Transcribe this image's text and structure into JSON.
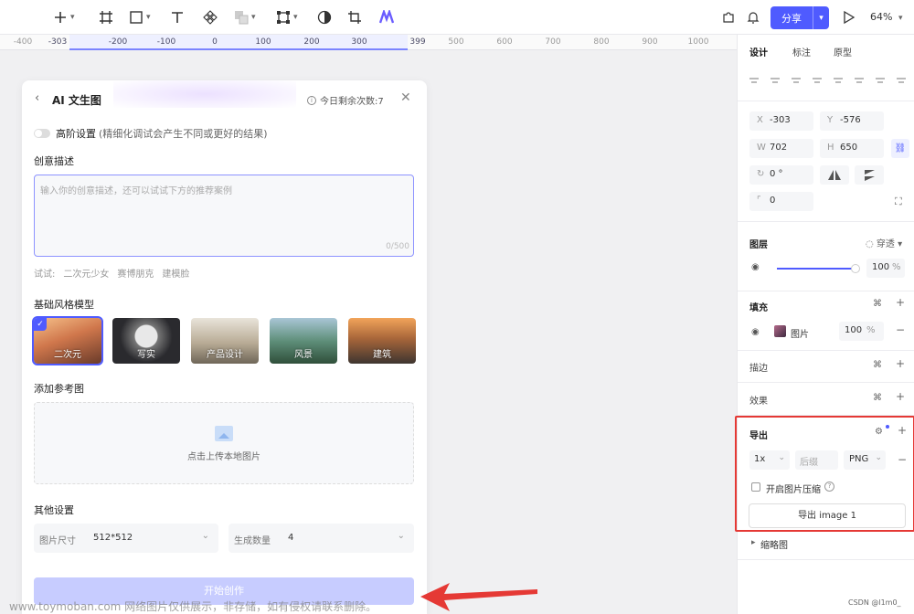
{
  "toolbar": {
    "share_label": "分享",
    "zoom": "64%"
  },
  "ruler": {
    "ticks": [
      "-400",
      "-303",
      "-200",
      "-100",
      "0",
      "100",
      "200",
      "300",
      "399",
      "500",
      "600",
      "700",
      "800",
      "900",
      "1000"
    ]
  },
  "ai_panel": {
    "title": "AI 文生图",
    "quota": "今日剩余次数:7",
    "advanced_label": "高阶设置",
    "advanced_hint": "(精细化调试会产生不同或更好的结果)",
    "prompt_label": "创意描述",
    "prompt_placeholder": "输入你的创意描述，还可以试试下方的推荐案例",
    "prompt_count": "0/500",
    "try_label": "试试:",
    "try_examples": [
      "二次元少女",
      "赛博朋克",
      "建模脸"
    ],
    "style_label": "基础风格模型",
    "styles": [
      "二次元",
      "写实",
      "产品设计",
      "风景",
      "建筑"
    ],
    "ref_label": "添加参考图",
    "upload_text": "点击上传本地图片",
    "other_label": "其他设置",
    "size_label": "图片尺寸",
    "size_value": "512*512",
    "count_label": "生成数量",
    "count_value": "4",
    "start_label": "开始创作"
  },
  "right_panel": {
    "tabs": [
      "设计",
      "标注",
      "原型"
    ],
    "x_label": "X",
    "x_value": "-303",
    "y_label": "Y",
    "y_value": "-576",
    "w_label": "W",
    "w_value": "702",
    "h_label": "H",
    "h_value": "650",
    "rotation": "0 °",
    "radius": "0",
    "layer_label": "图层",
    "blend_mode": "穿透",
    "opacity": "100",
    "pct": "%",
    "fill_label": "填充",
    "fill_type": "图片",
    "fill_opacity": "100",
    "stroke_label": "描边",
    "effect_label": "效果",
    "export_label": "导出",
    "export_scale": "1x",
    "export_suffix_placeholder": "后缀",
    "export_format": "PNG",
    "compress_label": "开启图片压缩",
    "export_button": "导出 image 1",
    "thumbnail_label": "缩略图"
  },
  "watermark": "www.toymoban.com 网络图片仅供展示，非存储，如有侵权请联系删除。",
  "credit": "CSDN @l1m0_"
}
